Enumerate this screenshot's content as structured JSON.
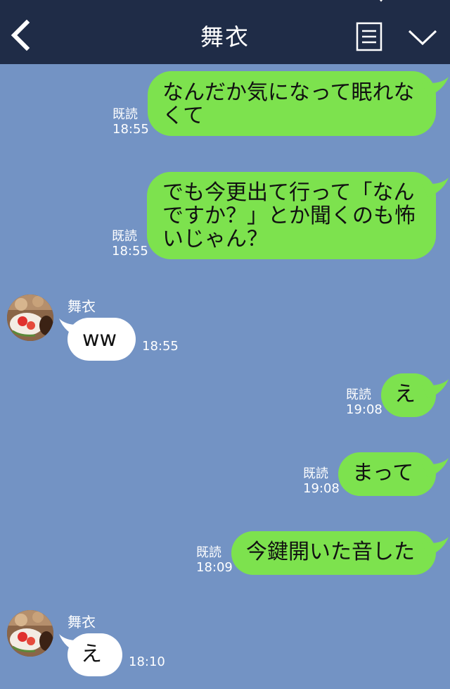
{
  "header": {
    "title": "舞衣",
    "back_icon": "chevron-left-icon",
    "menu_icon": "document-list-icon",
    "collapse_icon": "chevron-down-icon"
  },
  "colors": {
    "header_bg": "#1f2c47",
    "chat_bg": "#7393c4",
    "outgoing_bubble": "#7de24e",
    "incoming_bubble": "#ffffff",
    "meta_text": "#ffffff"
  },
  "messages": [
    {
      "direction": "out",
      "text": "なんだか気になって眠れな\nくて",
      "read": "既読",
      "time": "18:55"
    },
    {
      "direction": "out",
      "text": "でも今更出て行って「なん\nですか？」とか聞くのも怖\nいじゃん？",
      "read": "既読",
      "time": "18:55"
    },
    {
      "direction": "in",
      "sender": "舞衣",
      "text": "ww",
      "time": "18:55"
    },
    {
      "direction": "out",
      "text": "え",
      "read": "既読",
      "time": "19:08"
    },
    {
      "direction": "out",
      "text": "まって",
      "read": "既読",
      "time": "19:08"
    },
    {
      "direction": "out",
      "text": "今鍵開いた音した",
      "read": "既読",
      "time": "18:09"
    },
    {
      "direction": "in",
      "sender": "舞衣",
      "text": "え",
      "time": "18:10"
    }
  ]
}
